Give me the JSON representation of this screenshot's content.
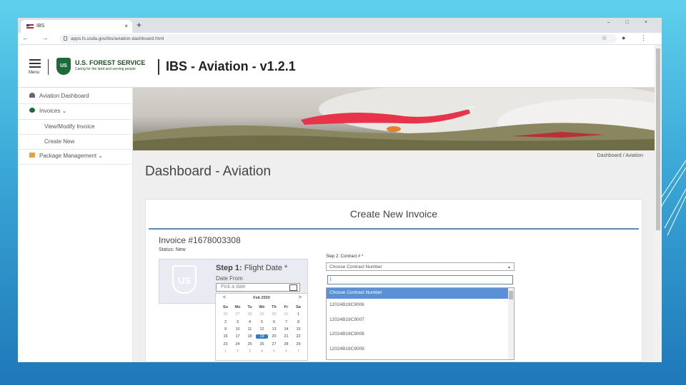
{
  "browser": {
    "tab_title": "IBS",
    "tab_close": "×",
    "new_tab": "+",
    "window_controls": "– □ ×",
    "nav_icons": "← → C",
    "url": "apps.fs.usda.gov/ibs/aviation-dashboard.html",
    "right_icons": "☆ ● ⋮"
  },
  "header": {
    "menu_label": "Menu",
    "agency_name": "U.S. FOREST SERVICE",
    "agency_tagline": "Caring for the land and serving people",
    "shield_text": "US",
    "app_title": "IBS - Aviation - v1.2.1"
  },
  "sidebar": {
    "items": [
      {
        "label": "Aviation Dashboard",
        "icon": "dashboard-icon"
      },
      {
        "label": "Invoices",
        "icon": "pie-chart-icon",
        "chevron": "⌄"
      },
      {
        "label": "View/Modify Invoice"
      },
      {
        "label": "Create New"
      },
      {
        "label": "Package Management",
        "icon": "folder-icon",
        "chevron": "⌄"
      }
    ]
  },
  "main": {
    "breadcrumb": "Dashboard / Aviation",
    "page_title": "Dashboard - Aviation",
    "card_title": "Create New Invoice",
    "invoice_number": "Invoice #1678003308",
    "status": "Status: New",
    "step1": {
      "title_bold": "Step 1:",
      "title_rest": " Flight Date *",
      "date_from_label": "Date From",
      "date_placeholder": "Pick a date",
      "watermark": "US"
    },
    "datepicker": {
      "prev": "<",
      "next": ">",
      "month": "Feb 2020",
      "days_of_week": [
        "Su",
        "Mo",
        "Tu",
        "We",
        "Th",
        "Fr",
        "Sa"
      ],
      "weeks": [
        [
          "26",
          "27",
          "28",
          "29",
          "30",
          "31",
          "1"
        ],
        [
          "2",
          "3",
          "4",
          "5",
          "6",
          "7",
          "8"
        ],
        [
          "9",
          "10",
          "11",
          "12",
          "13",
          "14",
          "15"
        ],
        [
          "16",
          "17",
          "18",
          "19",
          "20",
          "21",
          "22"
        ],
        [
          "23",
          "24",
          "25",
          "26",
          "27",
          "28",
          "29"
        ],
        [
          "1",
          "2",
          "3",
          "4",
          "5",
          "6",
          "7"
        ]
      ],
      "selected": "19"
    },
    "step2": {
      "label": "Step 2: Contract # *",
      "placeholder": "Choose Contract Number",
      "search_value": "|",
      "options": [
        "Choose Contract Number",
        "12024B19C9006",
        "12024B19C9007",
        "12024B19C9008",
        "12024B19C9009"
      ]
    }
  },
  "colors": {
    "accent": "#5b89b1",
    "selected_day": "#2f7ec2",
    "forest_green": "#1e6b3a"
  }
}
